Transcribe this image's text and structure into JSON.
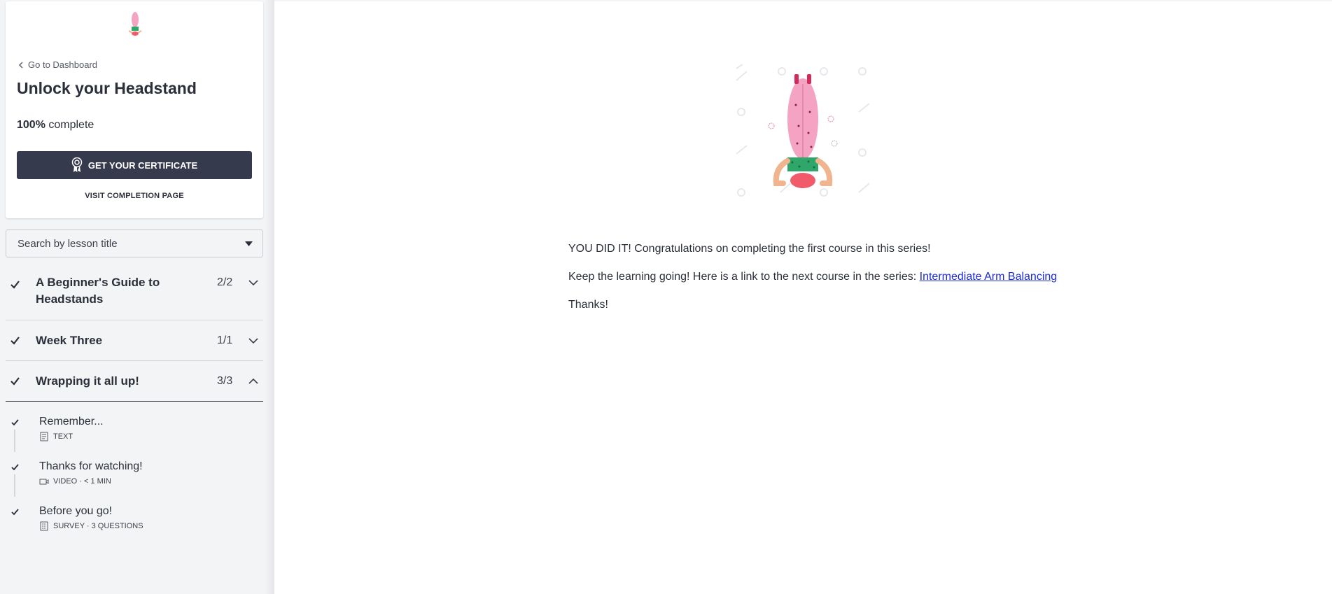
{
  "sidebar": {
    "back_link": "Go to Dashboard",
    "course_title": "Unlock your Headstand",
    "progress_percent": "100%",
    "progress_suffix": "complete",
    "certificate_button": "GET YOUR CERTIFICATE",
    "completion_link": "VISIT COMPLETION PAGE",
    "search_placeholder": "Search by lesson title",
    "chapters": [
      {
        "title": "A Beginner's Guide to Headstands",
        "count": "2/2",
        "expanded": false,
        "completed": true
      },
      {
        "title": "Week Three",
        "count": "1/1",
        "expanded": false,
        "completed": true
      },
      {
        "title": "Wrapping it all up!",
        "count": "3/3",
        "expanded": true,
        "completed": true
      }
    ],
    "lessons": [
      {
        "title": "Remember...",
        "meta": "TEXT",
        "icon": "text-document-icon",
        "completed": true
      },
      {
        "title": "Thanks for watching!",
        "meta": "VIDEO · < 1 MIN",
        "icon": "video-camera-icon",
        "completed": true
      },
      {
        "title": "Before you go!",
        "meta": "SURVEY · 3 QUESTIONS",
        "icon": "survey-clipboard-icon",
        "completed": true
      }
    ]
  },
  "main": {
    "paragraph1": "YOU DID IT! Congratulations on completing the first course in this series!",
    "paragraph2_prefix": "Keep the learning going! Here is a link to the next course in the series: ",
    "paragraph2_link": "Intermediate Arm Balancing",
    "paragraph3": "Thanks!"
  },
  "colors": {
    "accent_dark": "#363a4d",
    "link": "#1d2bd6",
    "text": "#2b2f3a"
  }
}
